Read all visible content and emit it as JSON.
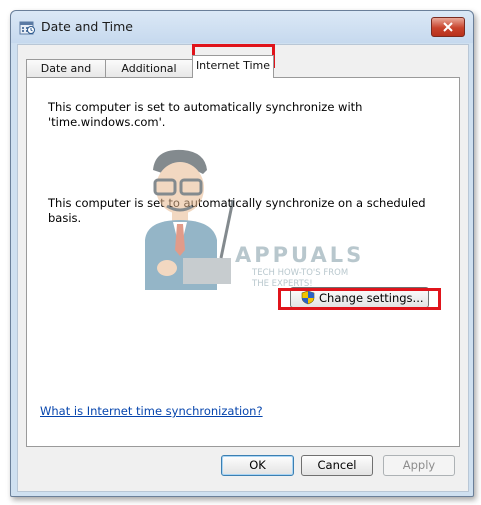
{
  "window": {
    "title": "Date and Time",
    "icon": "date-time-icon"
  },
  "tabs": [
    {
      "label": "Date and Time"
    },
    {
      "label": "Additional Clocks"
    },
    {
      "label": "Internet Time",
      "selected": true
    }
  ],
  "content": {
    "sync_message_1": "This computer is set to automatically synchronize with 'time.windows.com'.",
    "sync_message_2": "This computer is set to automatically synchronize on a scheduled basis.",
    "change_settings_label": "Change settings...",
    "help_link": "What is Internet time synchronization?"
  },
  "watermark": {
    "brand": "APPUALS",
    "tagline_1": "TECH HOW-TO'S FROM",
    "tagline_2": "THE EXPERTS!"
  },
  "buttons": {
    "ok": "OK",
    "cancel": "Cancel",
    "apply": "Apply"
  },
  "colors": {
    "highlight": "#e0141b",
    "link": "#0645ad"
  }
}
